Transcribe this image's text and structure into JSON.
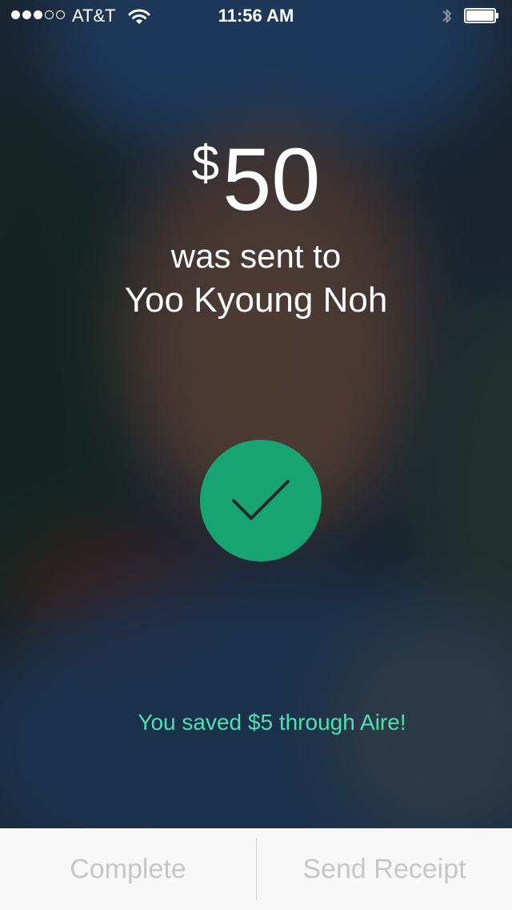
{
  "status_bar": {
    "signal_full": 3,
    "signal_total": 5,
    "carrier": "AT&T",
    "time": "11:56 AM",
    "icons": [
      "wifi-icon",
      "bluetooth-icon",
      "battery-icon"
    ],
    "battery_level": 1.0
  },
  "confirmation": {
    "currency_symbol": "$",
    "amount": "50",
    "sent_text": "was sent to",
    "recipient": "Yoo Kyoung Noh",
    "check_icon": "checkmark-icon",
    "savings_text": "You saved $5 through Aire!"
  },
  "actions": {
    "complete_label": "Complete",
    "send_receipt_label": "Send Receipt"
  },
  "colors": {
    "accent_green": "#18a472",
    "savings_text": "#4ee0b0",
    "button_text": "#c7c7c7",
    "bottom_bar": "#f8f8f8"
  }
}
